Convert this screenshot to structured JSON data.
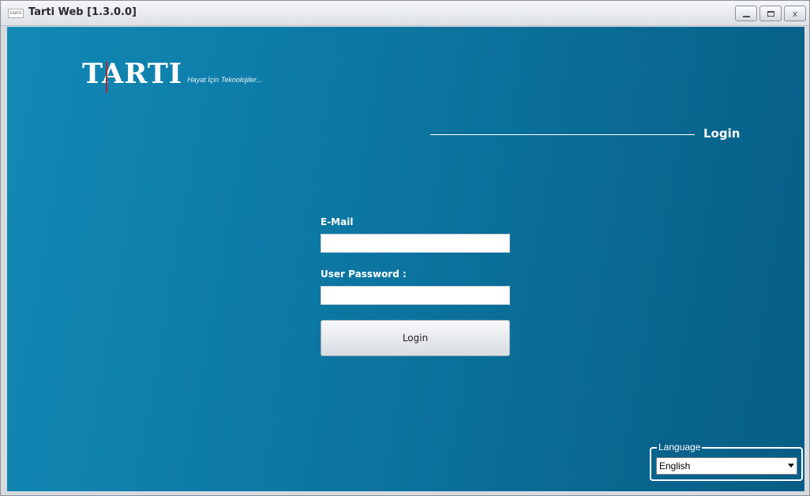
{
  "window": {
    "icon_text": "TARTI",
    "title": "Tarti Web [1.3.0.0]",
    "controls": {
      "minimize": "_",
      "maximize": "□",
      "close": "x"
    }
  },
  "brand": {
    "logo": "TARTI",
    "tagline": "Hayat İçin Teknolojiler..."
  },
  "login": {
    "heading": "Login",
    "email_label": "E-Mail",
    "email_value": "",
    "password_label": "User Password :",
    "password_value": "",
    "button_label": "Login"
  },
  "language": {
    "legend": "Language",
    "selected": "English"
  }
}
